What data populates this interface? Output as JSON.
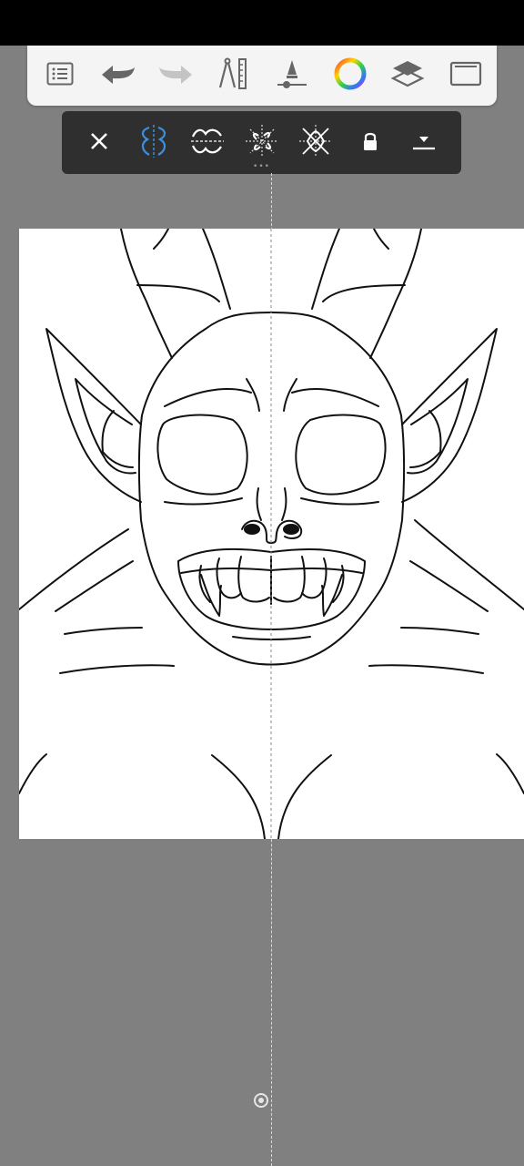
{
  "app": {
    "top_toolbar": {
      "items": [
        {
          "name": "list-icon"
        },
        {
          "name": "undo-icon"
        },
        {
          "name": "redo-icon"
        },
        {
          "name": "ruler-icon"
        },
        {
          "name": "brush-size-icon"
        },
        {
          "name": "color-wheel-icon"
        },
        {
          "name": "layers-icon"
        },
        {
          "name": "fullscreen-icon"
        }
      ]
    },
    "symmetry_toolbar": {
      "items": [
        {
          "name": "close-icon"
        },
        {
          "name": "vertical-symmetry-icon",
          "active": true
        },
        {
          "name": "horizontal-symmetry-icon"
        },
        {
          "name": "radial-symmetry-icon"
        },
        {
          "name": "rotary-symmetry-icon"
        },
        {
          "name": "lock-icon"
        },
        {
          "name": "collapse-icon"
        }
      ]
    },
    "colors": {
      "accent": "#3d8fe0",
      "toolbar_bg": "#f4f4f4",
      "symmetry_bar_bg": "#2f2f2f",
      "workspace_bg": "#808080",
      "canvas_bg": "#ffffff"
    }
  }
}
